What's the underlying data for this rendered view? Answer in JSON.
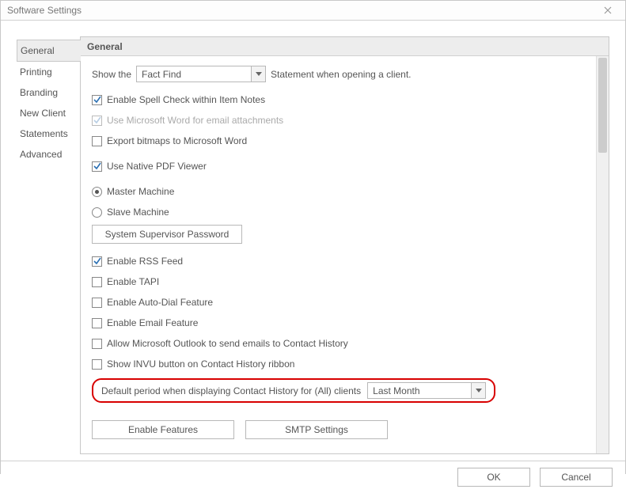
{
  "window": {
    "title": "Software Settings"
  },
  "tabs": {
    "items": [
      "General",
      "Printing",
      "Branding",
      "New Client",
      "Statements",
      "Advanced"
    ],
    "active_index": 0
  },
  "panel": {
    "title": "General"
  },
  "show_the": {
    "prefix": "Show the",
    "value": "Fact Find",
    "suffix": "Statement when opening a client."
  },
  "checks": {
    "spell": {
      "label": "Enable Spell Check within Item Notes",
      "checked": true,
      "disabled": false
    },
    "word": {
      "label": "Use Microsoft Word for email attachments",
      "checked": true,
      "disabled": true
    },
    "bitmaps": {
      "label": "Export bitmaps to Microsoft Word",
      "checked": false,
      "disabled": false
    },
    "pdf": {
      "label": "Use Native PDF Viewer",
      "checked": true,
      "disabled": false
    },
    "rss": {
      "label": "Enable RSS Feed",
      "checked": true,
      "disabled": false
    },
    "tapi": {
      "label": "Enable TAPI",
      "checked": false,
      "disabled": false
    },
    "autodial": {
      "label": "Enable Auto-Dial Feature",
      "checked": false,
      "disabled": false
    },
    "email": {
      "label": "Enable Email Feature",
      "checked": false,
      "disabled": false
    },
    "outlook": {
      "label": "Allow Microsoft Outlook to send emails to Contact History",
      "checked": false,
      "disabled": false
    },
    "invu": {
      "label": "Show INVU button on Contact History ribbon",
      "checked": false,
      "disabled": false
    }
  },
  "machine": {
    "master": "Master Machine",
    "slave": "Slave Machine",
    "selected": "master"
  },
  "buttons": {
    "supervisor": "System Supervisor Password",
    "features": "Enable Features",
    "smtp": "SMTP Settings"
  },
  "default_period": {
    "label": "Default period when displaying Contact History for (All) clients",
    "value": "Last Month"
  },
  "footer": {
    "ok": "OK",
    "cancel": "Cancel"
  }
}
